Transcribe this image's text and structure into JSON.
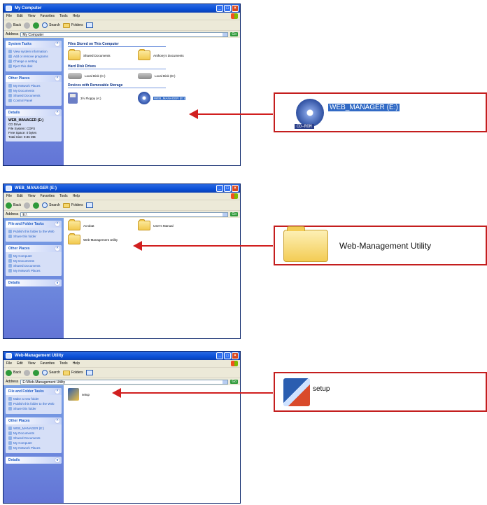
{
  "windows": [
    {
      "title": "My Computer",
      "menu": [
        "File",
        "Edit",
        "View",
        "Favorites",
        "Tools",
        "Help"
      ],
      "toolbar": {
        "back": "Back",
        "search": "Search",
        "folders": "Folders"
      },
      "address_label": "Address",
      "address": "My Computer",
      "go": "Go",
      "panels": [
        {
          "title": "System Tasks",
          "items": [
            "View system information",
            "Add or remove programs",
            "Change a setting",
            "Eject this disk"
          ]
        },
        {
          "title": "Other Places",
          "items": [
            "My Network Places",
            "My Documents",
            "Shared Documents",
            "Control Panel"
          ]
        },
        {
          "title": "Details",
          "lines": [
            "WEB_MANAGER (E:)",
            "CD Drive",
            "File System: CDFS",
            "Free Space: 0 bytes",
            "Total Size: 9.86 MB"
          ]
        }
      ],
      "groups": [
        {
          "title": "Files Stored on This Computer",
          "items": [
            "Shared Documents",
            "Anthony's Documents"
          ]
        },
        {
          "title": "Hard Disk Drives",
          "items": [
            "Local Disk (C:)",
            "Local Disk (D:)"
          ]
        },
        {
          "title": "Devices with Removable Storage",
          "items": [
            "3½ Floppy (A:)",
            "WEB_MANAGER (E:)"
          ]
        }
      ]
    },
    {
      "title": "WEB_MANAGER (E:)",
      "menu": [
        "File",
        "Edit",
        "View",
        "Favorites",
        "Tools",
        "Help"
      ],
      "toolbar": {
        "back": "Back",
        "search": "Search",
        "folders": "Folders"
      },
      "address_label": "Address",
      "address": "E:\\",
      "go": "Go",
      "panels": [
        {
          "title": "File and Folder Tasks",
          "items": [
            "Publish this folder to the Web",
            "Share this folder"
          ]
        },
        {
          "title": "Other Places",
          "items": [
            "My Computer",
            "My Documents",
            "Shared Documents",
            "My Network Places"
          ]
        },
        {
          "title": "Details",
          "lines": []
        }
      ],
      "items": [
        "Acrobat",
        "User's Manual",
        "Web-Management Utility"
      ]
    },
    {
      "title": "Web-Management Utility",
      "menu": [
        "File",
        "Edit",
        "View",
        "Favorites",
        "Tools",
        "Help"
      ],
      "toolbar": {
        "back": "Back",
        "search": "Search",
        "folders": "Folders"
      },
      "address_label": "Address",
      "address": "E:\\Web-Management Utility",
      "go": "Go",
      "panels": [
        {
          "title": "File and Folder Tasks",
          "items": [
            "Make a new folder",
            "Publish this folder to the Web",
            "Share this folder"
          ]
        },
        {
          "title": "Other Places",
          "items": [
            "WEB_MANAGER (E:)",
            "My Documents",
            "Shared Documents",
            "My Computer",
            "My Network Places"
          ]
        },
        {
          "title": "Details",
          "lines": []
        }
      ],
      "items": [
        "setup"
      ]
    }
  ],
  "callouts": [
    {
      "badge": "CD-ROM",
      "text": "WEB_MANAGER (E:)"
    },
    {
      "text": "Web-Management Utility"
    },
    {
      "text": "setup"
    }
  ],
  "colors": {
    "arrow": "#d11f1f",
    "callout_border": "#c41e1e",
    "titlebar": "#0a4fd6",
    "sidebar": "#6f8ee0"
  }
}
